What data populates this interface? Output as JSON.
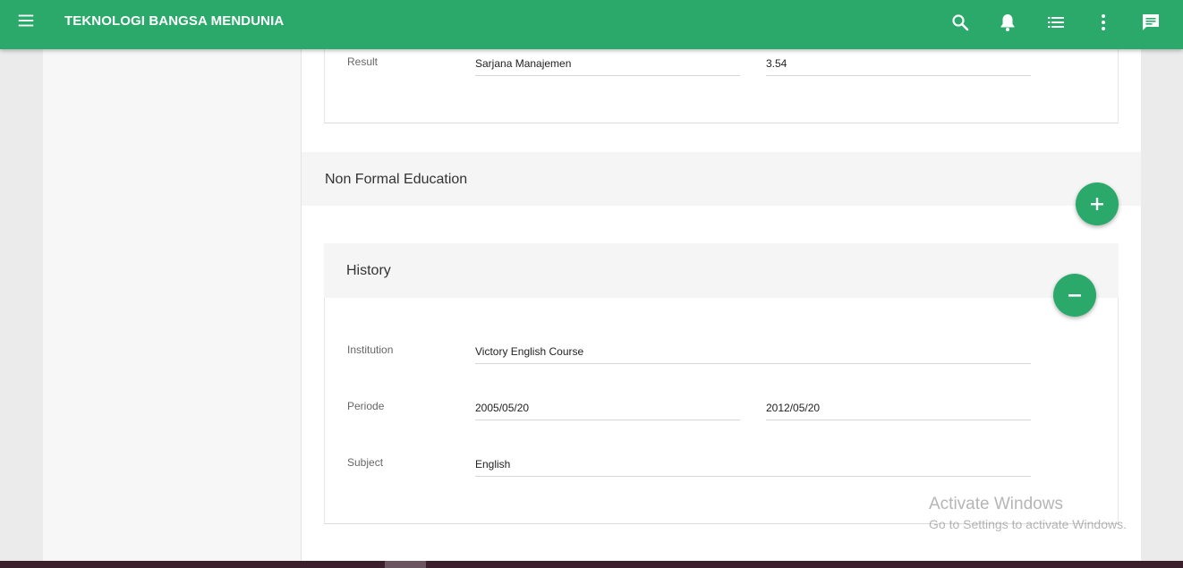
{
  "app": {
    "title": "TEKNOLOGI BANGSA MENDUNIA",
    "accent_color": "#2aa96b",
    "icons": [
      "menu-icon",
      "search-icon",
      "bell-icon",
      "list-icon",
      "more-vert-icon",
      "chat-icon"
    ]
  },
  "formal": {
    "result_label": "Result",
    "result_degree": "Sarjana Manajemen",
    "result_gpa": "3.54"
  },
  "non_formal": {
    "section_title": "Non Formal Education",
    "add_icon": "plus-icon",
    "history": {
      "title": "History",
      "remove_icon": "minus-icon",
      "institution_label": "Institution",
      "institution_value": "Victory English Course",
      "periode_label": "Periode",
      "periode_start": "2005/05/20",
      "periode_end": "2012/05/20",
      "subject_label": "Subject",
      "subject_value": "English"
    }
  },
  "watermark": {
    "line1": "Activate Windows",
    "line2": "Go to Settings to activate Windows."
  }
}
